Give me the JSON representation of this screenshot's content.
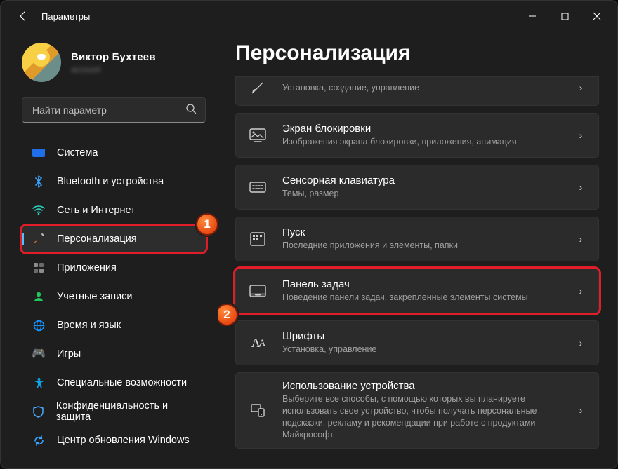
{
  "window": {
    "title": "Параметры"
  },
  "profile": {
    "name": "Виктор Бухтеев",
    "sub": "account"
  },
  "search": {
    "placeholder": "Найти параметр"
  },
  "sidebar": {
    "items": [
      {
        "label": "Система"
      },
      {
        "label": "Bluetooth и устройства"
      },
      {
        "label": "Сеть и Интернет"
      },
      {
        "label": "Персонализация"
      },
      {
        "label": "Приложения"
      },
      {
        "label": "Учетные записи"
      },
      {
        "label": "Время и язык"
      },
      {
        "label": "Игры"
      },
      {
        "label": "Специальные возможности"
      },
      {
        "label": "Конфиденциальность и защита"
      },
      {
        "label": "Центр обновления Windows"
      }
    ]
  },
  "page": {
    "heading": "Персонализация"
  },
  "cards": [
    {
      "title": "",
      "sub": "Установка, создание, управление"
    },
    {
      "title": "Экран блокировки",
      "sub": "Изображения экрана блокировки, приложения, анимация"
    },
    {
      "title": "Сенсорная клавиатура",
      "sub": "Темы, размер"
    },
    {
      "title": "Пуск",
      "sub": "Последние приложения и элементы, папки"
    },
    {
      "title": "Панель задач",
      "sub": "Поведение панели задач, закрепленные элементы системы"
    },
    {
      "title": "Шрифты",
      "sub": "Установка, управление"
    },
    {
      "title": "Использование устройства",
      "sub": "Выберите все способы, с помощью которых вы планируете использовать свое устройство, чтобы получать персональные подсказки, рекламу и рекомендации при работе с продуктами Майкрософт."
    }
  ],
  "callouts": {
    "one": "1",
    "two": "2"
  }
}
